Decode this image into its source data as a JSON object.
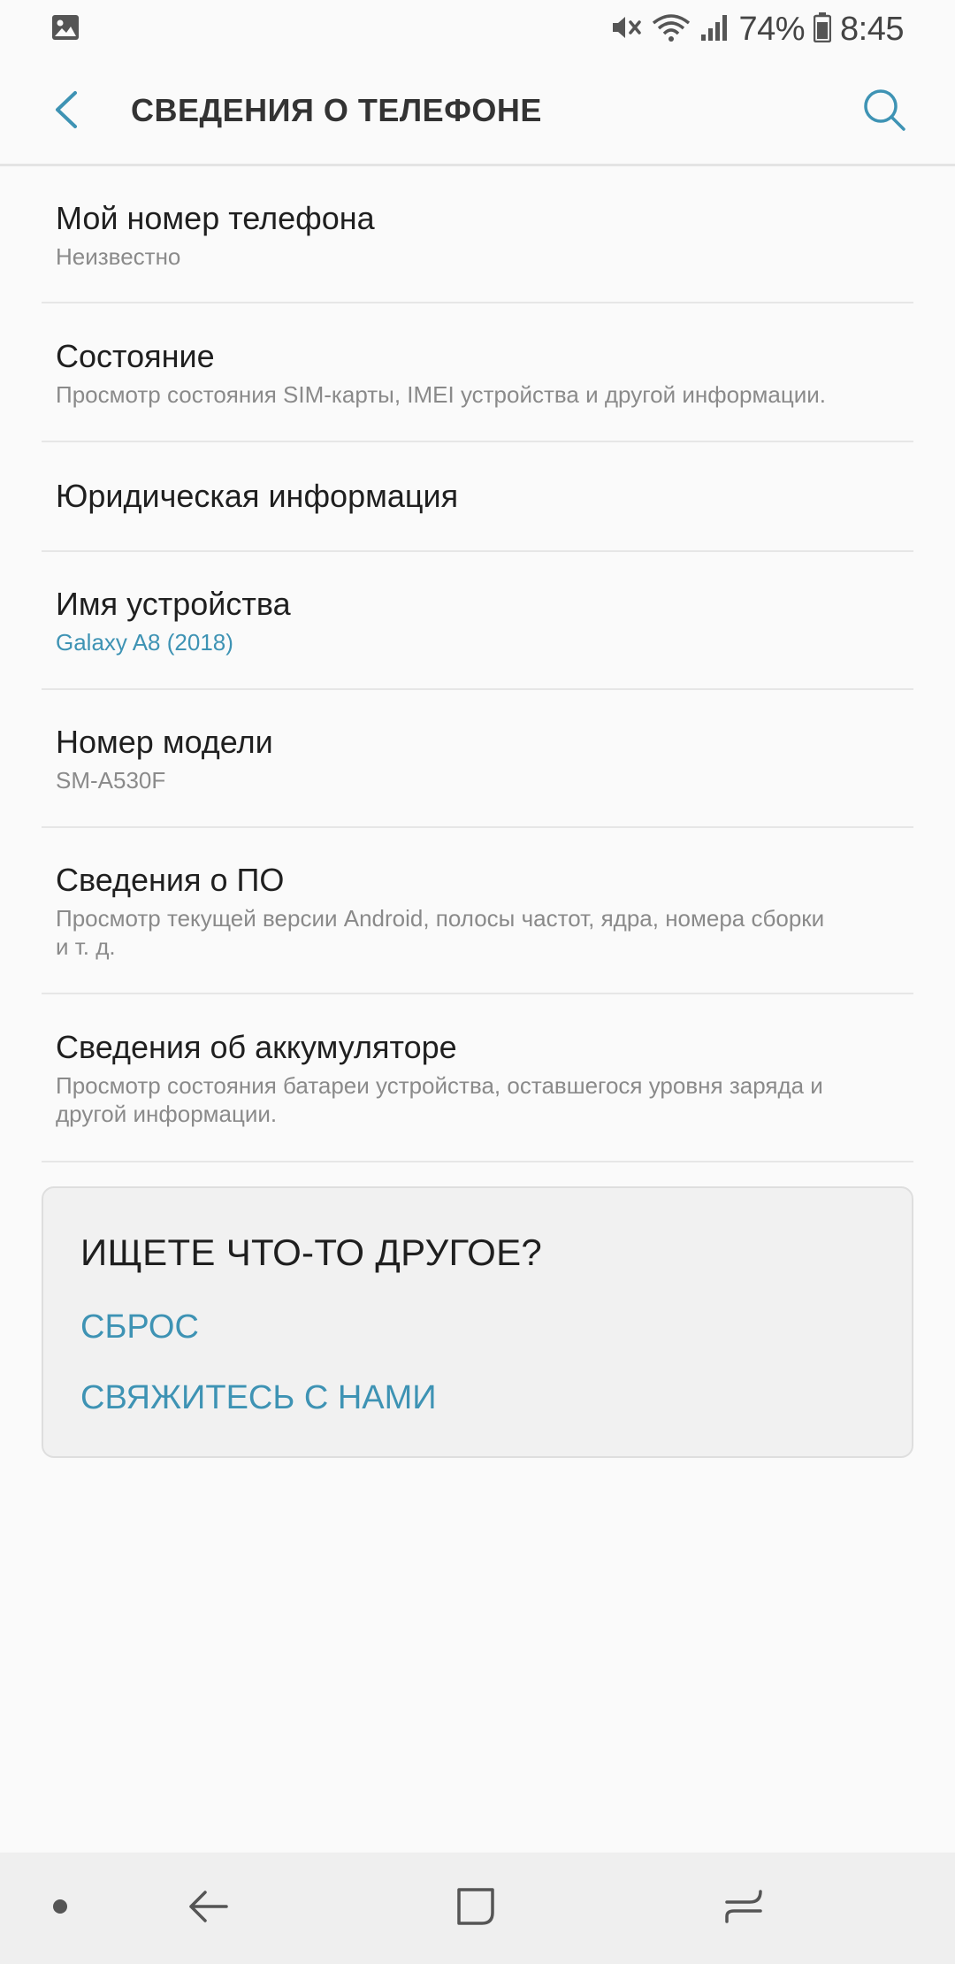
{
  "status_bar": {
    "battery": "74%",
    "time": "8:45",
    "icons": [
      "gallery-notification-icon",
      "mute-icon",
      "wifi-icon",
      "signal-icon",
      "battery-icon"
    ]
  },
  "app_bar": {
    "title": "СВЕДЕНИЯ О ТЕЛЕФОНЕ",
    "accent_color": "#3e93b4"
  },
  "items": [
    {
      "title": "Мой номер телефона",
      "subtitle": "Неизвестно"
    },
    {
      "title": "Состояние",
      "subtitle": "Просмотр состояния SIM-карты, IMEI устройства и другой информации."
    },
    {
      "title": "Юридическая информация"
    },
    {
      "title": "Имя устройства",
      "subtitle": "Galaxy A8 (2018)"
    },
    {
      "title": "Номер модели",
      "subtitle": "SM-A530F"
    },
    {
      "title": "Сведения о ПО",
      "subtitle_line1": "Просмотр текущей версии Android, полосы частот, ядра, номера сборки",
      "subtitle_line2": "и т. д."
    },
    {
      "title": "Сведения об аккумуляторе",
      "subtitle_line1": "Просмотр состояния батареи устройства, оставшегося уровня заряда и",
      "subtitle_line2": "другой информации."
    }
  ],
  "card": {
    "title": "ИЩЕТЕ ЧТО-ТО ДРУГОЕ?",
    "links": [
      "СБРОС",
      "СВЯЖИТЕСЬ С НАМИ"
    ]
  }
}
